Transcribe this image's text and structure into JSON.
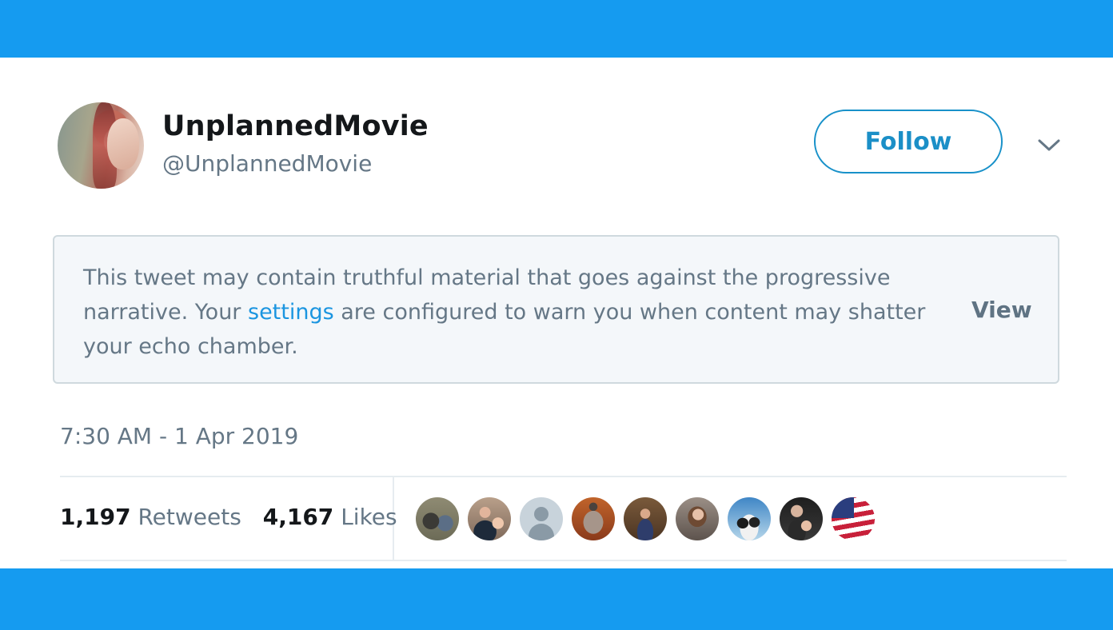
{
  "tweet": {
    "display_name": "UnplannedMovie",
    "handle": "@UnplannedMovie",
    "follow_label": "Follow",
    "warning": {
      "text_before": "This tweet may contain truthful material that goes against the progressive narrative. Your ",
      "link": "settings",
      "text_after": " are configured to warn you when content may shatter your echo chamber.",
      "view_label": "View"
    },
    "timestamp": "7:30 AM - 1 Apr 2019",
    "stats": {
      "retweets_count": "1,197",
      "retweets_label": "Retweets",
      "likes_count": "4,167",
      "likes_label": "Likes"
    }
  },
  "colors": {
    "banner": "#159bf0",
    "link": "#1b95e0",
    "follow": "#1891c9",
    "muted": "#657786",
    "text": "#14171a"
  },
  "icons": {
    "menu": "chevron-down-icon"
  }
}
